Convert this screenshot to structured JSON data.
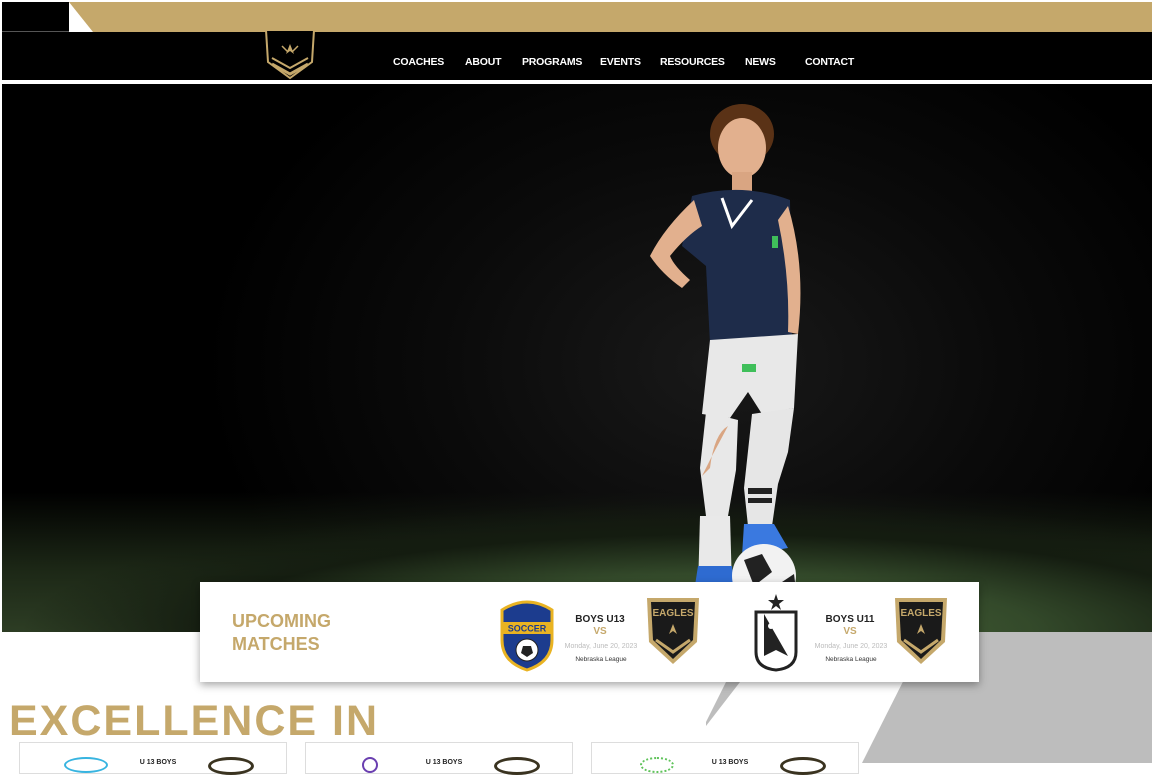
{
  "nav": {
    "items": [
      "COACHES",
      "ABOUT",
      "PROGRAMS",
      "EVENTS",
      "RESOURCES",
      "NEWS",
      "CONTACT"
    ]
  },
  "crest_icon": "eagles-crest-icon",
  "matches": {
    "title_line1": "UPCOMING",
    "title_line2": "MATCHES",
    "items": [
      {
        "team": "BOYS U13",
        "vs": "VS",
        "date": "Monday, June 20, 2023",
        "league": "Nebraska League",
        "opponent_logo": "championship-soccer-logo",
        "home_logo": "eagles-logo"
      },
      {
        "team": "BOYS U11",
        "vs": "VS",
        "date": "Monday, June 20, 2023",
        "league": "Nebraska League",
        "opponent_logo": "union-omaha-logo",
        "home_logo": "eagles-logo"
      }
    ]
  },
  "eagles_text": "EAGLES",
  "soccer_text": "SOCCER",
  "excellence": "EXCELLENCE IN",
  "bottom_cards": [
    {
      "team": "U 13 BOYS"
    },
    {
      "team": "U 13 BOYS"
    },
    {
      "team": "U 13 BOYS"
    }
  ],
  "colors": {
    "gold": "#c5a86b",
    "black": "#000000",
    "gray": "#bdbdbd"
  }
}
